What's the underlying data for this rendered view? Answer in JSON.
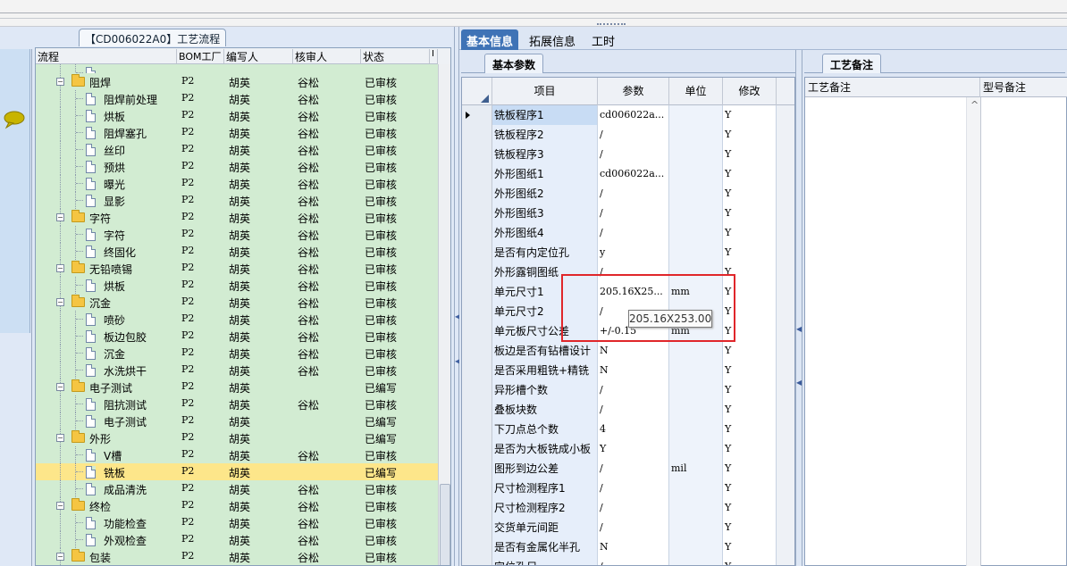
{
  "panel_title": "【CD006022A0】工艺流程",
  "tree": {
    "columns": [
      "流程",
      "BOM工厂",
      "编写人",
      "核审人",
      "状态",
      "I"
    ],
    "rows": [
      {
        "level": 2,
        "type": "doc",
        "name": "",
        "bom": "",
        "author": "",
        "reviewer": "",
        "status": "",
        "partial": true
      },
      {
        "level": 1,
        "type": "folder",
        "name": "阻焊",
        "bom": "P2",
        "author": "胡英",
        "reviewer": "谷松",
        "status": "已审核"
      },
      {
        "level": 2,
        "type": "doc",
        "name": "阻焊前处理",
        "bom": "P2",
        "author": "胡英",
        "reviewer": "谷松",
        "status": "已审核"
      },
      {
        "level": 2,
        "type": "doc",
        "name": "烘板",
        "bom": "P2",
        "author": "胡英",
        "reviewer": "谷松",
        "status": "已审核"
      },
      {
        "level": 2,
        "type": "doc",
        "name": "阻焊塞孔",
        "bom": "P2",
        "author": "胡英",
        "reviewer": "谷松",
        "status": "已审核"
      },
      {
        "level": 2,
        "type": "doc",
        "name": "丝印",
        "bom": "P2",
        "author": "胡英",
        "reviewer": "谷松",
        "status": "已审核"
      },
      {
        "level": 2,
        "type": "doc",
        "name": "预烘",
        "bom": "P2",
        "author": "胡英",
        "reviewer": "谷松",
        "status": "已审核"
      },
      {
        "level": 2,
        "type": "doc",
        "name": "曝光",
        "bom": "P2",
        "author": "胡英",
        "reviewer": "谷松",
        "status": "已审核"
      },
      {
        "level": 2,
        "type": "doc",
        "name": "显影",
        "bom": "P2",
        "author": "胡英",
        "reviewer": "谷松",
        "status": "已审核"
      },
      {
        "level": 1,
        "type": "folder",
        "name": "字符",
        "bom": "P2",
        "author": "胡英",
        "reviewer": "谷松",
        "status": "已审核"
      },
      {
        "level": 2,
        "type": "doc",
        "name": "字符",
        "bom": "P2",
        "author": "胡英",
        "reviewer": "谷松",
        "status": "已审核"
      },
      {
        "level": 2,
        "type": "doc",
        "name": "终固化",
        "bom": "P2",
        "author": "胡英",
        "reviewer": "谷松",
        "status": "已审核"
      },
      {
        "level": 1,
        "type": "folder",
        "name": "无铅喷锡",
        "bom": "P2",
        "author": "胡英",
        "reviewer": "谷松",
        "status": "已审核"
      },
      {
        "level": 2,
        "type": "doc",
        "name": "烘板",
        "bom": "P2",
        "author": "胡英",
        "reviewer": "谷松",
        "status": "已审核"
      },
      {
        "level": 1,
        "type": "folder",
        "name": "沉金",
        "bom": "P2",
        "author": "胡英",
        "reviewer": "谷松",
        "status": "已审核"
      },
      {
        "level": 2,
        "type": "doc",
        "name": "喷砂",
        "bom": "P2",
        "author": "胡英",
        "reviewer": "谷松",
        "status": "已审核"
      },
      {
        "level": 2,
        "type": "doc",
        "name": "板边包胶",
        "bom": "P2",
        "author": "胡英",
        "reviewer": "谷松",
        "status": "已审核"
      },
      {
        "level": 2,
        "type": "doc",
        "name": "沉金",
        "bom": "P2",
        "author": "胡英",
        "reviewer": "谷松",
        "status": "已审核"
      },
      {
        "level": 2,
        "type": "doc",
        "name": "水洗烘干",
        "bom": "P2",
        "author": "胡英",
        "reviewer": "谷松",
        "status": "已审核"
      },
      {
        "level": 1,
        "type": "folder",
        "name": "电子测试",
        "bom": "P2",
        "author": "胡英",
        "reviewer": "",
        "status": "已编写"
      },
      {
        "level": 2,
        "type": "doc",
        "name": "阻抗测试",
        "bom": "P2",
        "author": "胡英",
        "reviewer": "谷松",
        "status": "已审核"
      },
      {
        "level": 2,
        "type": "doc",
        "name": "电子测试",
        "bom": "P2",
        "author": "胡英",
        "reviewer": "",
        "status": "已编写"
      },
      {
        "level": 1,
        "type": "folder",
        "name": "外形",
        "bom": "P2",
        "author": "胡英",
        "reviewer": "",
        "status": "已编写"
      },
      {
        "level": 2,
        "type": "doc",
        "name": "V槽",
        "bom": "P2",
        "author": "胡英",
        "reviewer": "谷松",
        "status": "已审核"
      },
      {
        "level": 2,
        "type": "doc",
        "name": "铣板",
        "bom": "P2",
        "author": "胡英",
        "reviewer": "",
        "status": "已编写",
        "selected": true
      },
      {
        "level": 2,
        "type": "doc",
        "name": "成品清洗",
        "bom": "P2",
        "author": "胡英",
        "reviewer": "谷松",
        "status": "已审核"
      },
      {
        "level": 1,
        "type": "folder",
        "name": "终检",
        "bom": "P2",
        "author": "胡英",
        "reviewer": "谷松",
        "status": "已审核"
      },
      {
        "level": 2,
        "type": "doc",
        "name": "功能检查",
        "bom": "P2",
        "author": "胡英",
        "reviewer": "谷松",
        "status": "已审核"
      },
      {
        "level": 2,
        "type": "doc",
        "name": "外观检查",
        "bom": "P2",
        "author": "胡英",
        "reviewer": "谷松",
        "status": "已审核"
      },
      {
        "level": 1,
        "type": "folder",
        "name": "包装",
        "bom": "P2",
        "author": "胡英",
        "reviewer": "谷松",
        "status": "已审核"
      }
    ]
  },
  "main_tabs": [
    "基本信息",
    "拓展信息",
    "工时"
  ],
  "basic_params": {
    "subtab": "基本参数",
    "columns": [
      "项目",
      "参数",
      "单位",
      "修改"
    ],
    "rows": [
      {
        "item": "铣板程序1",
        "param": "cd006022a...",
        "unit": "",
        "mod": "Y",
        "current": true
      },
      {
        "item": "铣板程序2",
        "param": "/",
        "unit": "",
        "mod": "Y"
      },
      {
        "item": "铣板程序3",
        "param": "/",
        "unit": "",
        "mod": "Y"
      },
      {
        "item": "外形图纸1",
        "param": "cd006022a...",
        "unit": "",
        "mod": "Y"
      },
      {
        "item": "外形图纸2",
        "param": "/",
        "unit": "",
        "mod": "Y"
      },
      {
        "item": "外形图纸3",
        "param": "/",
        "unit": "",
        "mod": "Y"
      },
      {
        "item": "外形图纸4",
        "param": "/",
        "unit": "",
        "mod": "Y"
      },
      {
        "item": "是否有内定位孔",
        "param": "y",
        "unit": "",
        "mod": "Y"
      },
      {
        "item": "外形露铜图纸",
        "param": "/",
        "unit": "",
        "mod": "Y"
      },
      {
        "item": "单元尺寸1",
        "param": "205.16X25...",
        "unit": "mm",
        "mod": "Y"
      },
      {
        "item": "单元尺寸2",
        "param": "/",
        "unit": "",
        "mod": "Y"
      },
      {
        "item": "单元板尺寸公差",
        "param": "+/-0.15",
        "unit": "mm",
        "mod": "Y"
      },
      {
        "item": "板边是否有钻槽设计",
        "param": "N",
        "unit": "",
        "mod": "Y"
      },
      {
        "item": "是否采用粗铣+精铣",
        "param": "N",
        "unit": "",
        "mod": "Y"
      },
      {
        "item": "异形槽个数",
        "param": "/",
        "unit": "",
        "mod": "Y"
      },
      {
        "item": "叠板块数",
        "param": "/",
        "unit": "",
        "mod": "Y"
      },
      {
        "item": "下刀点总个数",
        "param": "4",
        "unit": "",
        "mod": "Y"
      },
      {
        "item": "是否为大板铣成小板",
        "param": "Y",
        "unit": "",
        "mod": "Y"
      },
      {
        "item": "图形到边公差",
        "param": "/",
        "unit": "mil",
        "mod": "Y"
      },
      {
        "item": "尺寸检测程序1",
        "param": "/",
        "unit": "",
        "mod": "Y"
      },
      {
        "item": "尺寸检测程序2",
        "param": "/",
        "unit": "",
        "mod": "Y"
      },
      {
        "item": "交货单元间距",
        "param": "/",
        "unit": "",
        "mod": "Y"
      },
      {
        "item": "是否有金属化半孔",
        "param": "N",
        "unit": "",
        "mod": "Y"
      },
      {
        "item": "定位孔尺",
        "param": "/",
        "unit": "",
        "mod": "Y"
      }
    ]
  },
  "tooltip": "205.16X253.00",
  "process_notes": {
    "subtab": "工艺备注",
    "columns": [
      "工艺备注",
      "型号备注"
    ]
  }
}
